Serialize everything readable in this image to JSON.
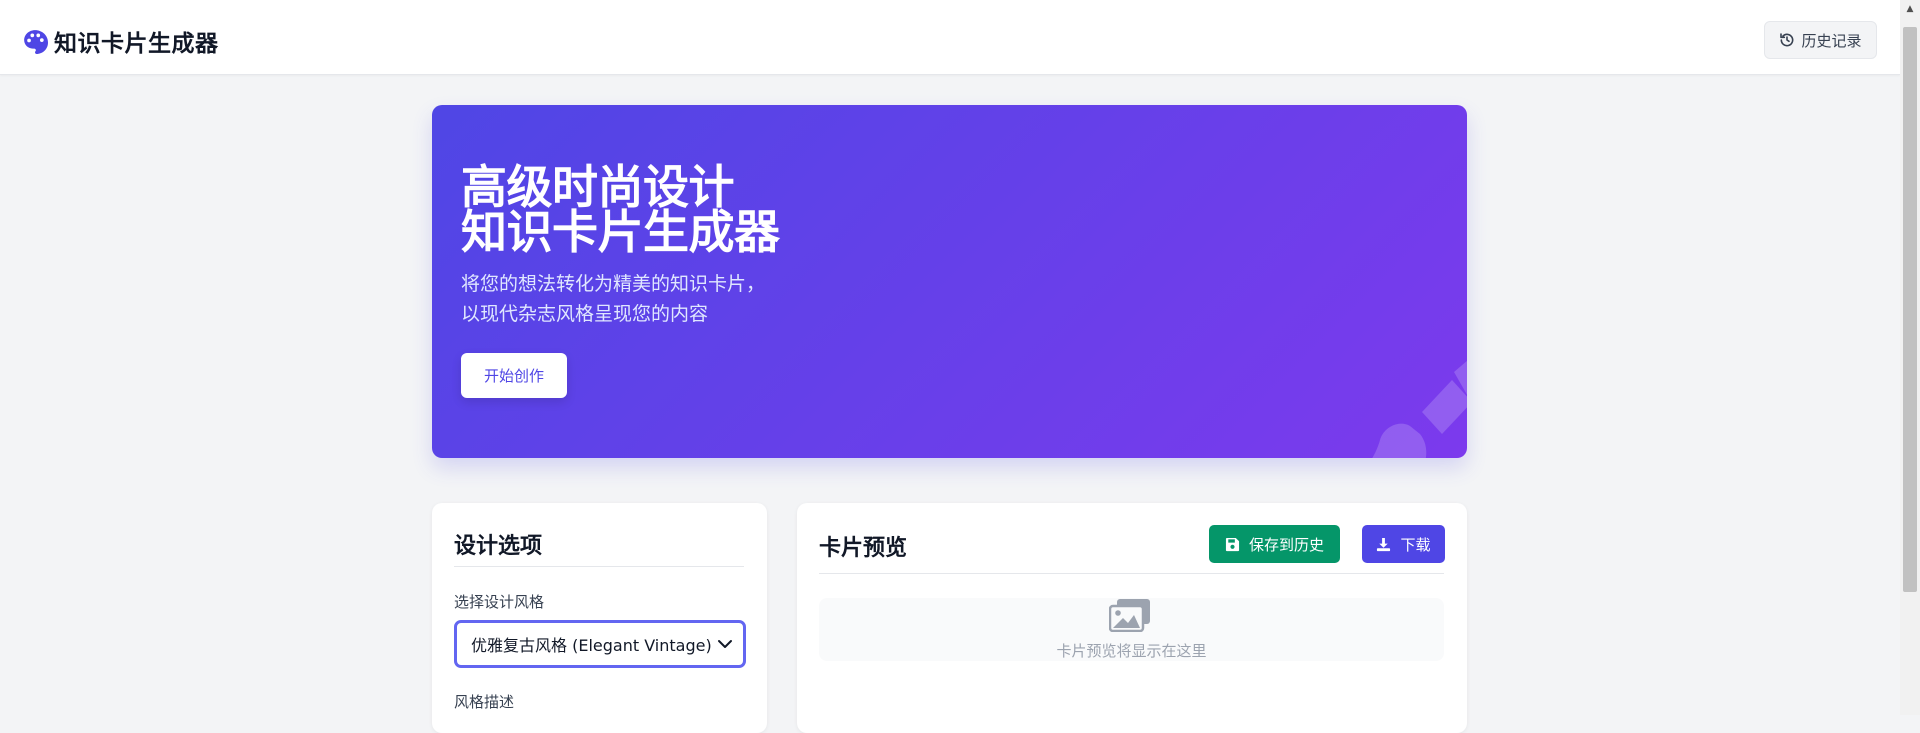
{
  "header": {
    "brand_icon": "palette-icon",
    "title": "知识卡片生成器",
    "history_button": {
      "label": "历史记录",
      "icon": "history-icon"
    }
  },
  "hero": {
    "title_line1": "高级时尚设计",
    "title_line2": "知识卡片生成器",
    "subtitle_line1": "将您的想法转化为精美的知识卡片，",
    "subtitle_line2": "以现代杂志风格呈现您的内容",
    "cta_label": "开始创作",
    "decoration_icon": "paint-brush-icon",
    "gradient_colors": [
      "#4f46e5",
      "#7c3aed"
    ]
  },
  "design_options": {
    "heading": "设计选项",
    "style_label": "选择设计风格",
    "style_selected": "优雅复古风格 (Elegant Vintage)",
    "description_label": "风格描述"
  },
  "preview": {
    "heading": "卡片预览",
    "save_button": {
      "label": "保存到历史",
      "icon": "save-icon",
      "color": "#059669"
    },
    "download_button": {
      "label": "下载",
      "icon": "download-icon",
      "color": "#4f46e5"
    },
    "placeholder_icon": "images-icon",
    "placeholder_text": "卡片预览将显示在这里"
  }
}
